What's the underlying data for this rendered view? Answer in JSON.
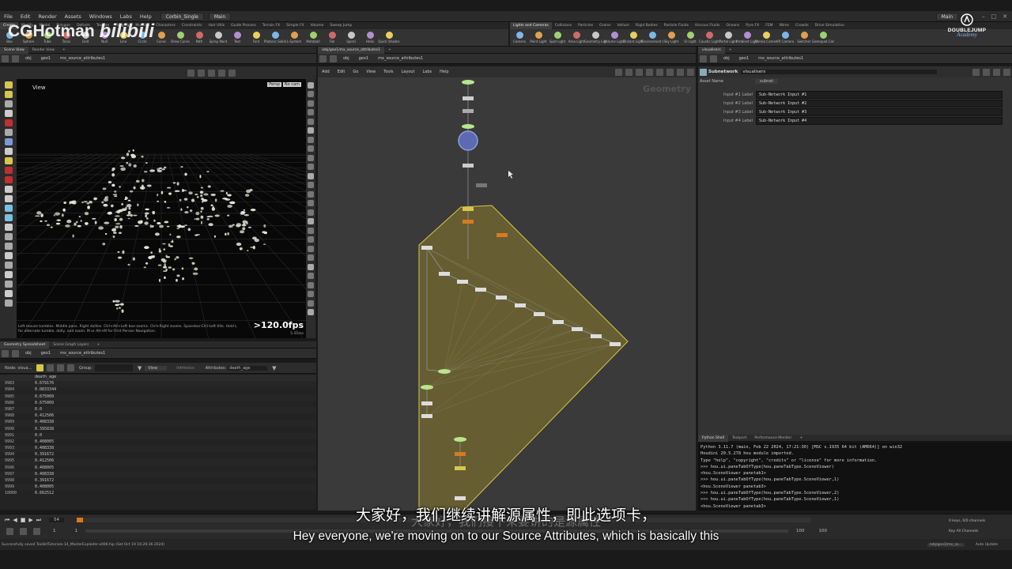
{
  "colors": {
    "accent_yellow": "#d6c74a",
    "node_green": "#b8e68a",
    "node_orange": "#d97a1e",
    "network_bg": "#3a3a3a",
    "subnet_fill": "#8a7a2c",
    "viewport_bg": "#080808"
  },
  "menubar": {
    "items": [
      "File",
      "Edit",
      "Render",
      "Assets",
      "Windows",
      "Labs",
      "Help"
    ],
    "desktop": "Corbin_Single",
    "context": "Main",
    "right_context": "Main"
  },
  "shelf": {
    "left_tabs": [
      "Create",
      "Modify",
      "Model",
      "Polygon",
      "Deform",
      "Texture",
      "Rigging",
      "Muscles",
      "Characters",
      "Constraints",
      "Hair Utils",
      "Guide Process",
      "Terrain FX",
      "Simple FX",
      "Volume",
      "Sweep Jump"
    ],
    "right_tabs": [
      "Lights and Cameras",
      "Collisions",
      "Particles",
      "Grains",
      "Vellum",
      "Rigid Bodies",
      "Particle Fluids",
      "Viscous Fluids",
      "Oceans",
      "Pyro FX",
      "FEM",
      "Wires",
      "Crowds",
      "Drive Simulation"
    ],
    "left_tools": [
      "Box",
      "Sphere",
      "Tube",
      "Torus",
      "Grid",
      "Null",
      "Line",
      "Circle",
      "Curve",
      "Draw Curve",
      "Path",
      "Spray Paint",
      "Text",
      "Font",
      "Platonic Solids",
      "L-System",
      "Metaball",
      "File",
      "Spiral",
      "Helix",
      "Quick Shades"
    ],
    "right_tools": [
      "Camera",
      "Point Light",
      "Spot Light",
      "Area Light",
      "Geometry Light",
      "Volume Light",
      "Distant Light",
      "Environment Light",
      "Sky Light",
      "GI Light",
      "Caustic Light",
      "Portal Light",
      "Ambient Light",
      "Stereo Camera",
      "VR Camera",
      "Switcher",
      "Gamepad Camera"
    ]
  },
  "left_pane": {
    "tabs": [
      "Scene View",
      "Render View"
    ],
    "path": [
      "obj",
      "geo1",
      "mx_source_attributes1"
    ],
    "view_label": "View",
    "persp_label": "Persp",
    "cam_label": "No cam",
    "fps": ">120.0fps",
    "ms": "5.31ms",
    "hint": "Left mouse tumbles. Middle pans. Right dollies. Ctrl+Alt+Left box-zooms. Ctrl+Right zooms. Spacebar-Ctrl-Left tilts. Hold L for alternate tumble, dolly, and zoom. M or Alt+M for First Person Navigation."
  },
  "spreadsheet": {
    "tabs": [
      "Geometry Spreadsheet",
      "Scene Graph Layers"
    ],
    "path": [
      "obj",
      "geo1",
      "mx_source_attributes1"
    ],
    "node_label": "Node: visua...",
    "group_label": "Group:",
    "view_label": "View",
    "intrinsics_label": "Intrinsics",
    "attributes_label": "Attributes:",
    "attributes_value": "death_age",
    "column": "death_age",
    "rows": [
      {
        "i": "9983",
        "v": "0.679176"
      },
      {
        "i": "9984",
        "v": "0.0833344"
      },
      {
        "i": "9985",
        "v": "0.675009"
      },
      {
        "i": "9986",
        "v": "0.675009"
      },
      {
        "i": "9987",
        "v": "0.0"
      },
      {
        "i": "9988",
        "v": "0.412506"
      },
      {
        "i": "9989",
        "v": "0.408338"
      },
      {
        "i": "9990",
        "v": "0.395838"
      },
      {
        "i": "9991",
        "v": "0.0"
      },
      {
        "i": "9992",
        "v": "0.408005"
      },
      {
        "i": "9993",
        "v": "0.408338"
      },
      {
        "i": "9994",
        "v": "0.391672"
      },
      {
        "i": "9995",
        "v": "0.412506"
      },
      {
        "i": "9996",
        "v": "0.408005"
      },
      {
        "i": "9997",
        "v": "0.408338"
      },
      {
        "i": "9998",
        "v": "0.391672"
      },
      {
        "i": "9999",
        "v": "0.408005"
      },
      {
        "i": "10000",
        "v": "0.662512"
      }
    ]
  },
  "network_pane": {
    "tab": "/obj/geo1/mx_source_attributes1",
    "path": [
      "obj",
      "geo1",
      "mx_source_attributes1"
    ],
    "menu": [
      "Add",
      "Edit",
      "Go",
      "View",
      "Tools",
      "Layout",
      "Labs",
      "Help"
    ],
    "context_label": "Geometry"
  },
  "params": {
    "tab": "visualisers",
    "path": [
      "obj",
      "geo1",
      "mx_source_attributes1"
    ],
    "type_label": "Subnetwork",
    "node_name": "visualisers",
    "asset_name_label": "Asset Name",
    "asset_name_value": "subnet",
    "inputs": [
      {
        "label": "Input #1 Label",
        "value": "Sub-Network Input #1"
      },
      {
        "label": "Input #2 Label",
        "value": "Sub-Network Input #2"
      },
      {
        "label": "Input #3 Label",
        "value": "Sub-Network Input #3"
      },
      {
        "label": "Input #4 Label",
        "value": "Sub-Network Input #4"
      }
    ]
  },
  "python_shell": {
    "tabs": [
      "Python Shell",
      "Textport",
      "Performance Monitor"
    ],
    "lines": [
      "Python 3.11.7 (main, Feb 22 2024, 17:21:30) [MSC v.1935 64 bit (AMD64)] on win32",
      "Houdini 20.5.278 hou module imported.",
      "Type \"help\", \"copyright\", \"credits\" or \"license\" for more information.",
      ">>> hou.ui.paneTabOfType(hou.paneTabType.SceneViewer)",
      "<hou.SceneViewer panetab1>",
      ">>> hou.ui.paneTabOfType(hou.paneTabType.SceneViewer,1)",
      "<hou.SceneViewer panetab3>",
      ">>> hou.ui.paneTabOfType(hou.paneTabType.SceneViewer,2)",
      ">>> hou.ui.paneTabOfType(hou.paneTabType.SceneViewer,1)",
      "<hou.SceneViewer panetab3>"
    ]
  },
  "timeline": {
    "current_frame": "54",
    "start_frame": "1",
    "start_range": "1",
    "end_range": "100",
    "end_frame": "100",
    "keys_label": "0 keys, 0/0 channels",
    "key_all_label": "Key All Channels",
    "auto_update": "Auto Update",
    "obj_path": "/obj/geo1/mx_so..."
  },
  "status": {
    "message": "Successfully saved ToolkitTutorials-14_MasterExploder-v006.hip (Sat Oct 19 16:26:36 2024)"
  },
  "watermark": {
    "left_text": "CGHotman",
    "left_logo": "bilibili",
    "right_text": "DOUBLEJUMP",
    "right_sub": "Academy"
  },
  "subtitles": {
    "chinese": "大家好，我们继续讲解源属性，即此选项卡，",
    "english": "Hey everyone, we're moving on to our Source Attributes, which is basically this",
    "ghost": "大家好，我们接下来要讲的是源属性"
  }
}
